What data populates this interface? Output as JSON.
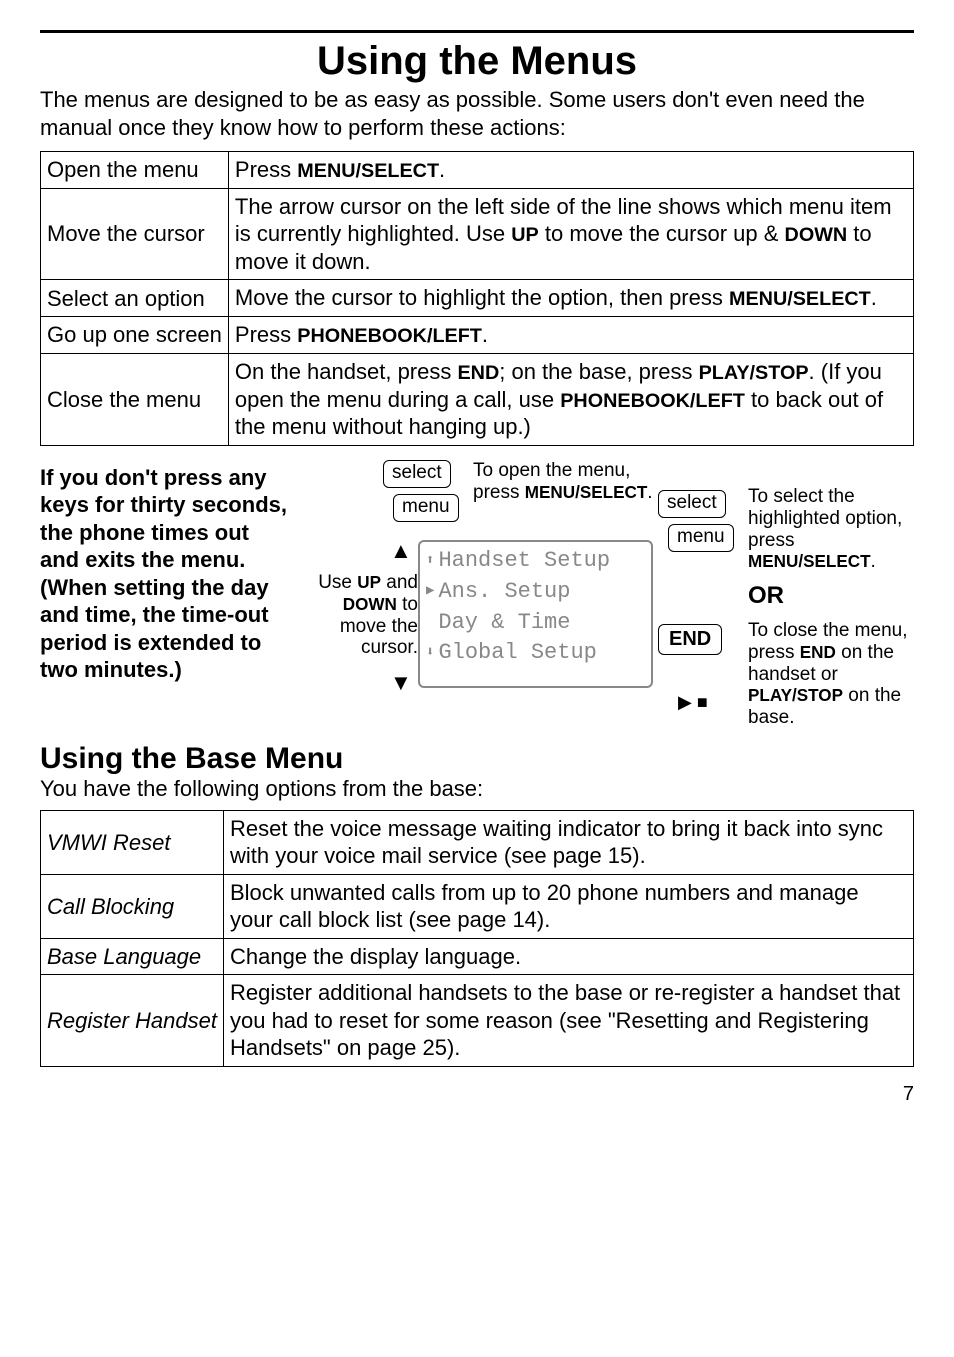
{
  "title": "Using the Menus",
  "intro": "The menus are designed to be as easy as possible. Some users don't even need the manual once they know how to perform these actions:",
  "actions_table": {
    "rows": [
      {
        "action": "Open the menu",
        "desc_pre": "Press ",
        "key1": "MENU/SELECT",
        "desc_post": "."
      },
      {
        "action": "Move the cursor",
        "desc_pre": "The arrow cursor on the left side of the line shows which menu item is currently highlighted. Use ",
        "key1": "UP",
        "desc_mid": " to move the cursor up & ",
        "key2": "DOWN",
        "desc_post": " to move it down."
      },
      {
        "action": "Select an option",
        "desc_pre": "Move the cursor to highlight the option, then press ",
        "key1": "MENU/SELECT",
        "desc_post": "."
      },
      {
        "action": "Go up one screen",
        "desc_pre": "Press ",
        "key1": "PHONEBOOK/LEFT",
        "desc_post": "."
      },
      {
        "action": "Close the menu",
        "desc_pre": "On the handset, press ",
        "key1": "END",
        "desc_mid": "; on the base, press ",
        "key2": "PLAY/STOP",
        "desc_mid2": ". (If you open the menu during a call, use ",
        "key3": "PHONEBOOK/LEFT",
        "desc_post": " to back out of the menu without hanging up.)"
      }
    ]
  },
  "diagram": {
    "timeout_note": "If you don't press any keys for thirty seconds, the phone times out and exits the menu. (When setting the day and time, the time-out period is extended to two minutes.)",
    "balloon_select": "select",
    "balloon_menu": "menu",
    "balloon_end": "END",
    "note_open_pre": "To open the menu, press ",
    "note_open_key": "MENU/SELECT",
    "note_open_post": ".",
    "note_updown_pre": "Use ",
    "note_updown_key1": "UP",
    "note_updown_mid": " and ",
    "note_updown_key2": "DOWN",
    "note_updown_post": " to move the cursor.",
    "note_select_pre": "To select the highlighted option, press ",
    "note_select_key": "MENU/SELECT",
    "note_select_post": ".",
    "note_or": "OR",
    "note_close_pre": "To close the menu, press ",
    "note_close_key1": "END",
    "note_close_mid": " on the handset or ",
    "note_close_key2": "PLAY/STOP",
    "note_close_post": " on the base.",
    "lcd_lines": [
      "Handset Setup",
      "Ans. Setup",
      "Day & Time",
      "Global Setup"
    ]
  },
  "base_menu": {
    "heading": "Using the Base Menu",
    "intro": "You have the following options from the base:",
    "rows": [
      {
        "name": "VMWI Reset",
        "desc": "Reset the voice message waiting indicator to bring it back into sync with your voice mail service (see page 15)."
      },
      {
        "name": "Call Blocking",
        "desc": "Block unwanted calls from up to 20 phone numbers and manage your call block list (see page 14)."
      },
      {
        "name": "Base Language",
        "desc": "Change the display language."
      },
      {
        "name": "Register Handset",
        "desc": "Register additional handsets to the base or re-register a handset that you had to reset for some reason (see \"Resetting and Registering Handsets\" on page 25)."
      }
    ]
  },
  "page_number": "7"
}
